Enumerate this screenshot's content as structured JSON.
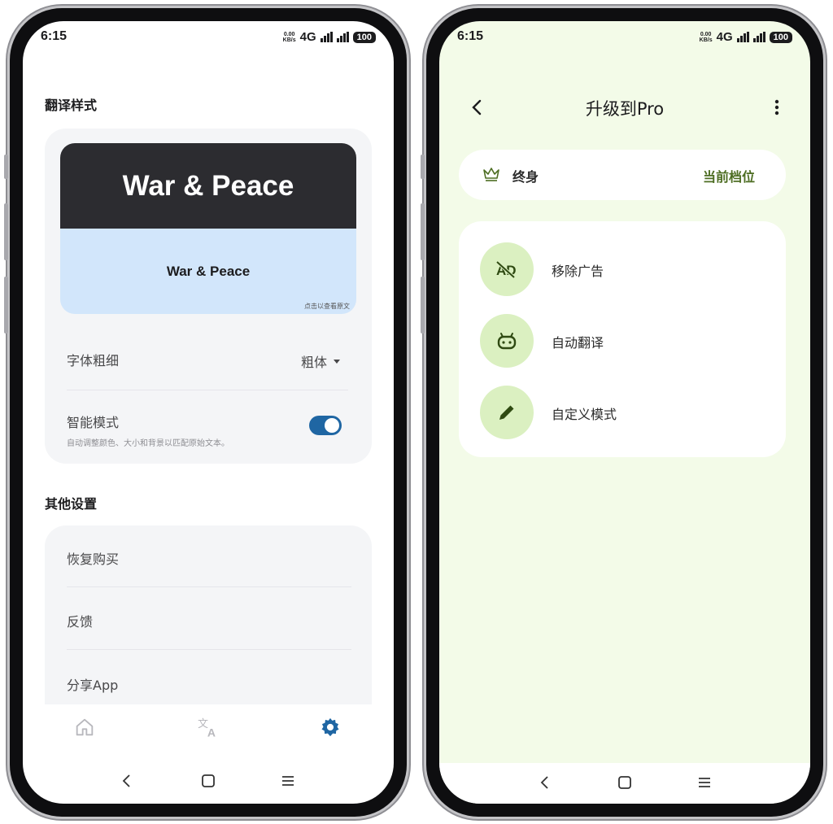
{
  "left": {
    "status": {
      "time": "6:15",
      "speed_top": "0.00",
      "speed_bottom": "KB/s",
      "network": "4G",
      "battery": "100"
    },
    "style_section": {
      "title": "翻译样式",
      "preview_title": "War & Peace",
      "preview_translation": "War & Peace",
      "preview_hint": "点击以查看原文",
      "font_weight_label": "字体粗细",
      "font_weight_value": "粗体",
      "smart_mode_label": "智能模式",
      "smart_mode_desc": "自动调整颜色、大小和背景以匹配原始文本。",
      "smart_mode_enabled": true
    },
    "other_section": {
      "title": "其他设置",
      "items": [
        {
          "label": "恢复购买"
        },
        {
          "label": "反馈"
        },
        {
          "label": "分享App"
        }
      ]
    },
    "bottom_nav": {
      "items": [
        "home-icon",
        "translate-icon",
        "settings-icon"
      ],
      "active": "settings-icon",
      "active_color": "#1f66a3"
    }
  },
  "right": {
    "status": {
      "time": "6:15",
      "speed_top": "0.00",
      "speed_bottom": "KB/s",
      "network": "4G",
      "battery": "100"
    },
    "title": "升级到Pro",
    "tier": {
      "label": "终身",
      "status": "当前档位"
    },
    "features": [
      {
        "label": "移除广告",
        "icon": "remove-ads-icon"
      },
      {
        "label": "自动翻译",
        "icon": "android-robot-icon"
      },
      {
        "label": "自定义模式",
        "icon": "pencil-icon"
      }
    ],
    "accent_color": "#4d6d22",
    "background_color": "#f3fbe8"
  }
}
